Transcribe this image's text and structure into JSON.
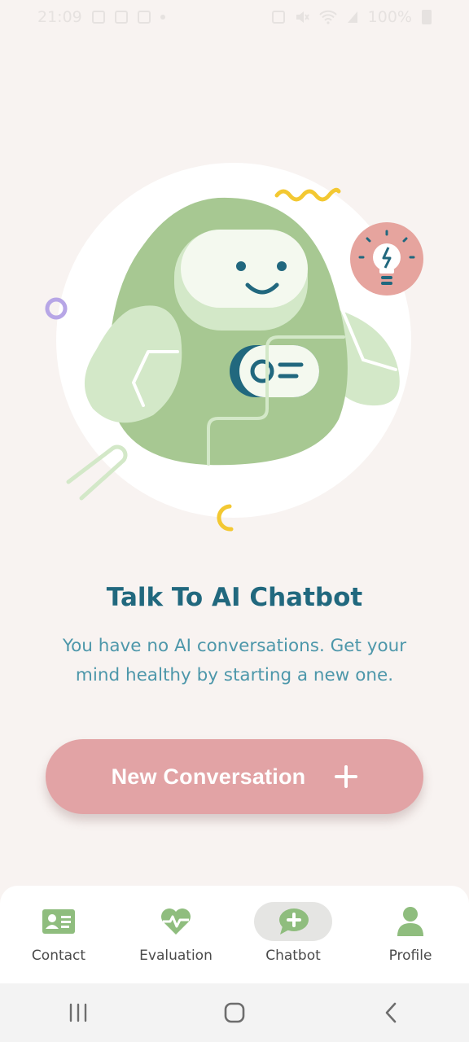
{
  "status_bar": {
    "time": "21:09",
    "battery": "100%",
    "icons": [
      "gallery-icon",
      "facebook-icon",
      "app-notification-icon",
      "dot-icon",
      "alarm-icon",
      "mute-icon",
      "wifi-icon",
      "signal-icon",
      "battery-icon"
    ]
  },
  "illustration": {
    "name": "friendly-robot-chatbot",
    "colors": {
      "circle": "#ffffff",
      "body": "#a7c892",
      "light_green": "#d3e8c8",
      "face": "#f4f9ef",
      "accent_teal": "#21687e",
      "bulb_bg": "#e6a49e",
      "yellow": "#f3c832",
      "purple": "#b7a6e6"
    }
  },
  "main": {
    "title": "Talk To AI Chatbot",
    "subtitle": "You have no AI conversations. Get your mind healthy by starting a new one.",
    "cta_label": "New Conversation"
  },
  "bottom_nav": {
    "items": [
      {
        "label": "Contact",
        "icon": "contact-card-icon",
        "active": false
      },
      {
        "label": "Evaluation",
        "icon": "heart-pulse-icon",
        "active": false
      },
      {
        "label": "Chatbot",
        "icon": "chat-plus-icon",
        "active": true
      },
      {
        "label": "Profile",
        "icon": "person-icon",
        "active": false
      }
    ],
    "icon_color": "#8fbd7e"
  },
  "system_nav": {
    "buttons": [
      "recent-apps-icon",
      "home-icon",
      "back-icon"
    ]
  }
}
